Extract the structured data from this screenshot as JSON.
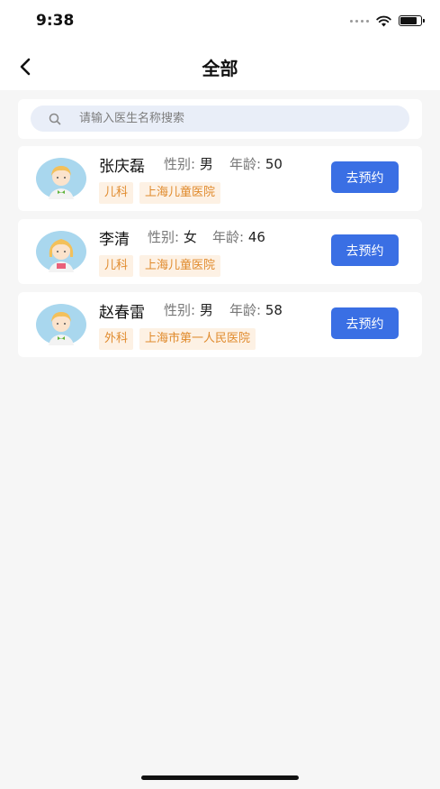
{
  "status": {
    "time": "9:38",
    "battery_level": 0.85
  },
  "nav": {
    "title": "全部",
    "back_icon": "chevron-left-icon"
  },
  "search": {
    "placeholder": "请输入医生名称搜索",
    "value": "",
    "icon": "search-icon"
  },
  "doctors": [
    {
      "name": "张庆磊",
      "gender_label": "性别:",
      "gender": "男",
      "age_label": "年龄:",
      "age": "50",
      "department": "儿科",
      "hospital": "上海儿童医院",
      "button": "去预约",
      "avatar": "male-doctor-avatar"
    },
    {
      "name": "李清",
      "gender_label": "性别:",
      "gender": "女",
      "age_label": "年龄:",
      "age": "46",
      "department": "儿科",
      "hospital": "上海儿童医院",
      "button": "去预约",
      "avatar": "female-doctor-avatar"
    },
    {
      "name": "赵春雷",
      "gender_label": "性别:",
      "gender": "男",
      "age_label": "年龄:",
      "age": "58",
      "department": "外科",
      "hospital": "上海市第一人民医院",
      "button": "去预约",
      "avatar": "male-doctor-avatar"
    }
  ],
  "colors": {
    "accent": "#3a6fe4",
    "tag_bg": "#fdf1e4",
    "tag_text": "#e08a2c",
    "page_bg": "#f6f6f6"
  }
}
